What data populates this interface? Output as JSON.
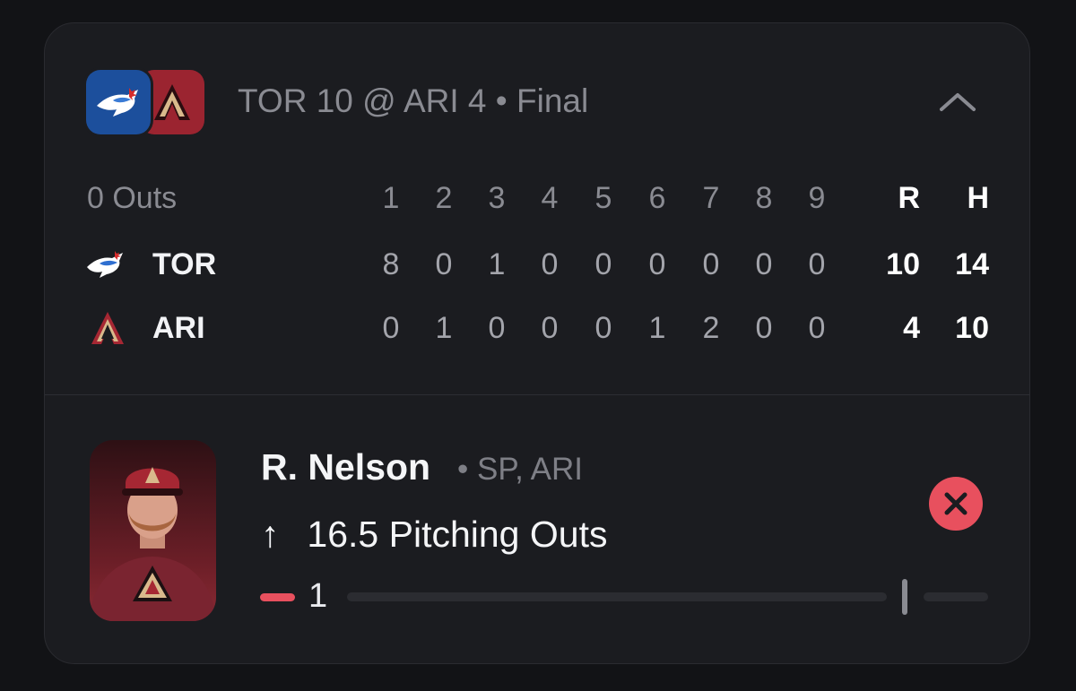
{
  "game": {
    "summary": "TOR 10 @ ARI 4 • Final",
    "outs_label": "0 Outs",
    "innings": [
      "1",
      "2",
      "3",
      "4",
      "5",
      "6",
      "7",
      "8",
      "9"
    ],
    "total_headers": [
      "R",
      "H"
    ],
    "teams": [
      {
        "abbr": "TOR",
        "innings": [
          "8",
          "0",
          "1",
          "0",
          "0",
          "0",
          "0",
          "0",
          "0"
        ],
        "runs": "10",
        "hits": "14",
        "color": "#1c4f9c"
      },
      {
        "abbr": "ARI",
        "innings": [
          "0",
          "1",
          "0",
          "0",
          "0",
          "1",
          "2",
          "0",
          "0"
        ],
        "runs": "4",
        "hits": "10",
        "color": "#9b2430"
      }
    ],
    "collapse_icon": "chevron-up-icon"
  },
  "player": {
    "name": "R. Nelson",
    "meta": "• SP, ARI",
    "prop_arrow": "↑",
    "prop_line": "16.5",
    "prop_stat": "Pitching Outs",
    "current_value": "1",
    "progress_fraction": 0.06,
    "status_color": "#e8505e",
    "remove_icon": "close-icon"
  }
}
